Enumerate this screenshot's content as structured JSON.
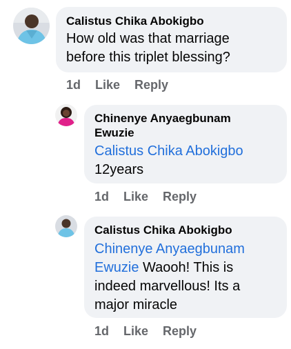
{
  "comments": [
    {
      "author": "Calistus Chika Abokigbo",
      "mention": "",
      "text": "How old was that marriage before this triplet blessing?",
      "time": "1d",
      "like_label": "Like",
      "reply_label": "Reply"
    },
    {
      "author": "Chinenye Anyaegbunam Ewuzie",
      "mention": "Calistus Chika Abokigbo",
      "text": "12years",
      "time": "1d",
      "like_label": "Like",
      "reply_label": "Reply"
    },
    {
      "author": "Calistus Chika Abokigbo",
      "mention": "Chinenye Anyaegbunam Ewuzie",
      "text": "Waooh! This is indeed marvellous! Its a major miracle",
      "time": "1d",
      "like_label": "Like",
      "reply_label": "Reply"
    }
  ],
  "colors": {
    "bubble": "#f0f2f5",
    "mention": "#216fdb",
    "meta": "#65676b"
  }
}
